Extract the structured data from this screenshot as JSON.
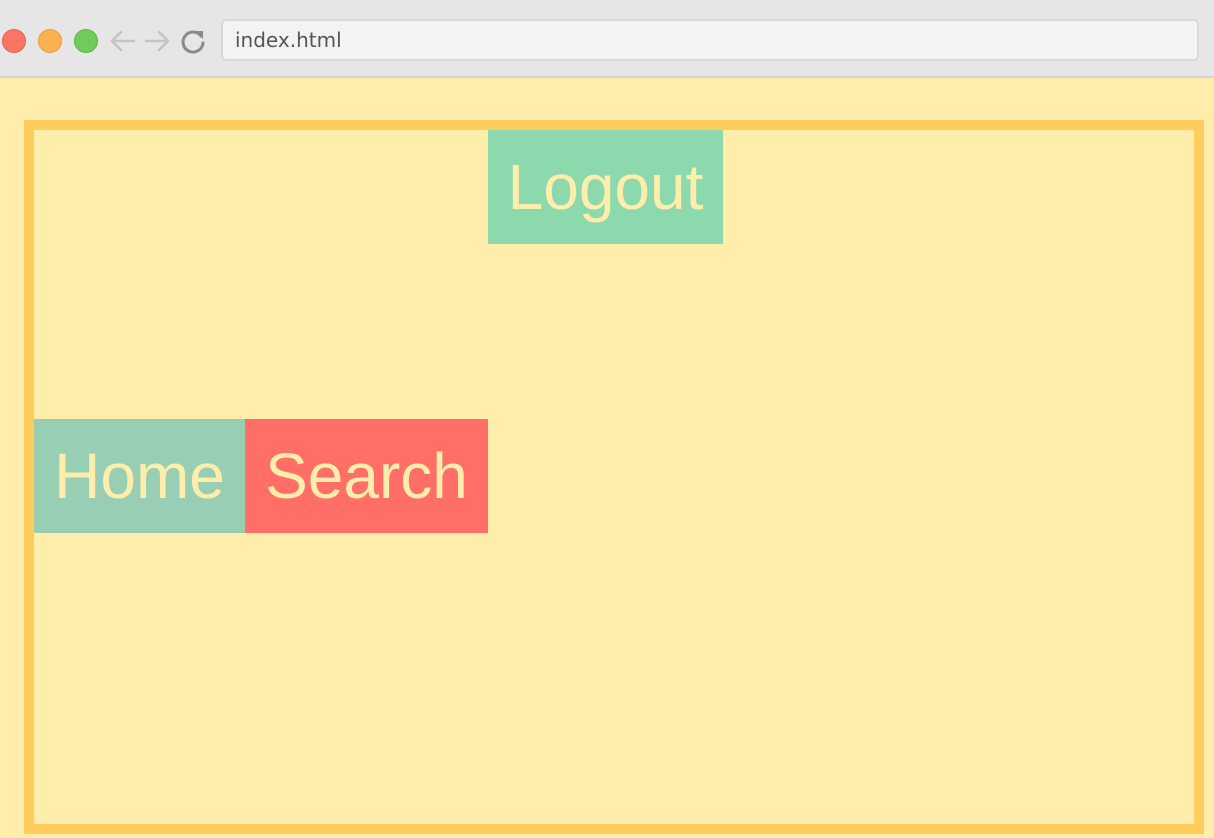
{
  "browser": {
    "url": "index.html"
  },
  "page": {
    "nav": {
      "logout_label": "Logout",
      "home_label": "Home",
      "search_label": "Search"
    }
  },
  "colors": {
    "page_background": "#FFEDAB",
    "frame_border": "#FFCD5B",
    "logout_bg": "#8CD9AE",
    "home_bg": "#98CFB4",
    "search_bg": "#FF6F67",
    "link_text": "#FFEDAB"
  }
}
